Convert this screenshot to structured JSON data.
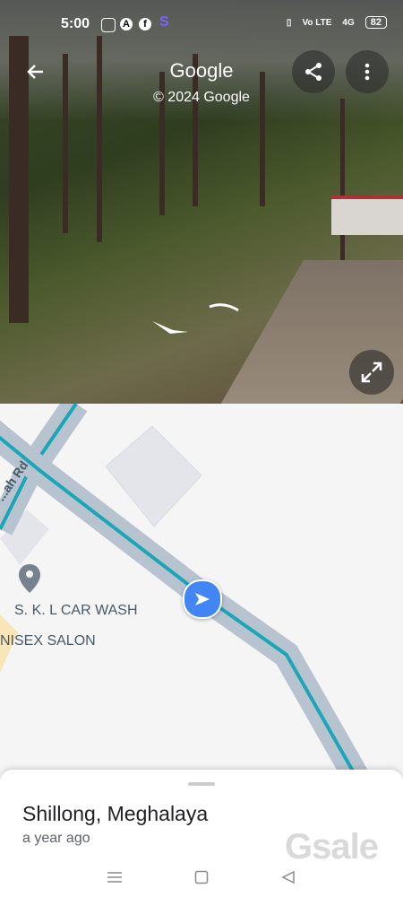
{
  "status_bar": {
    "time": "5:00",
    "network": "4G",
    "volte": "Vo LTE",
    "battery": "82"
  },
  "street_view": {
    "title": "Google",
    "copyright": "© 2024 Google"
  },
  "map": {
    "road_label": "...ah Rd",
    "poi_1": "S. K. L CAR WASH",
    "poi_2": "NISEX SALON",
    "colors": {
      "route": "#1aa6b7",
      "road": "#b8c3d0",
      "location": "#4285f4"
    }
  },
  "bottom_sheet": {
    "place": "Shillong, Meghalaya",
    "time_ago": "a year ago",
    "watermark": "Gsale"
  },
  "icons": [
    "back-arrow-icon",
    "share-icon",
    "more-vert-icon",
    "expand-icon",
    "map-pin-icon",
    "navigation-arrow-icon",
    "menu-icon",
    "home-square-icon",
    "back-triangle-icon"
  ]
}
